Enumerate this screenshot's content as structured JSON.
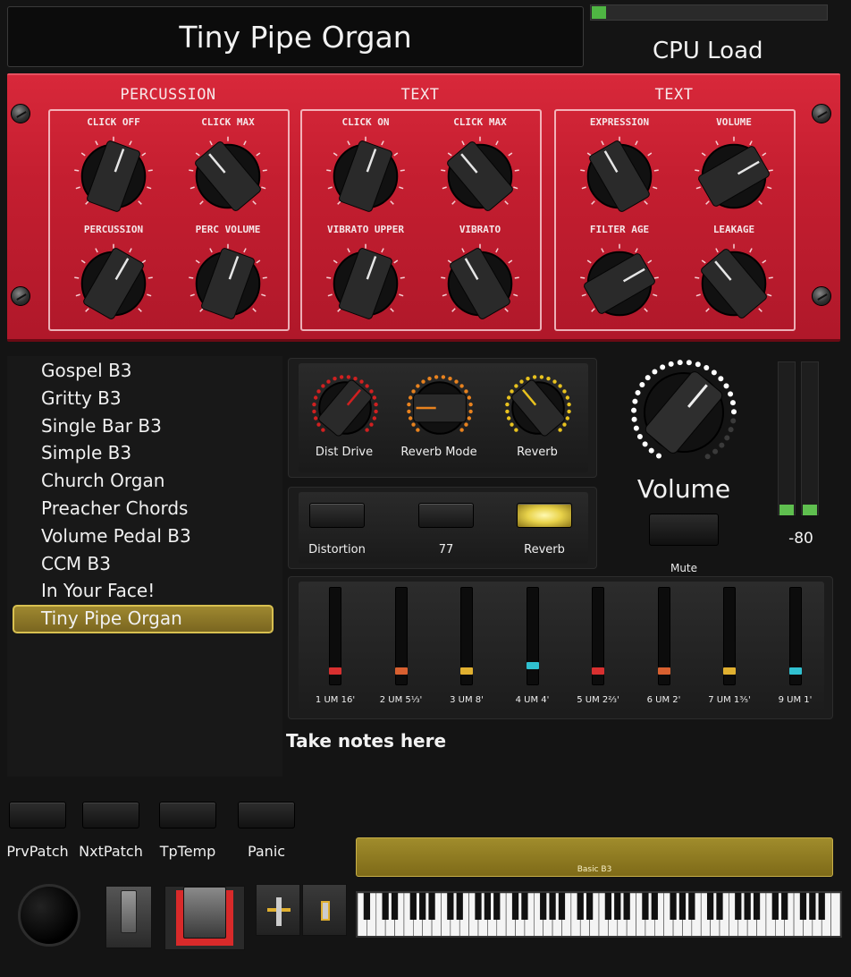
{
  "header": {
    "patch_title": "Tiny Pipe Organ",
    "cpu_label": "CPU Load",
    "cpu_load_fraction": 0.07
  },
  "organ_panel": {
    "sections": [
      {
        "label": "PERCUSSION",
        "knobs": [
          {
            "label": "CLICK OFF"
          },
          {
            "label": "CLICK MAX"
          },
          {
            "label": "PERCUSSION"
          },
          {
            "label": "PERC VOLUME"
          }
        ]
      },
      {
        "label": "TEXT",
        "knobs": [
          {
            "label": "CLICK ON"
          },
          {
            "label": "CLICK MAX"
          },
          {
            "label": "VIBRATO UPPER"
          },
          {
            "label": "VIBRATO"
          }
        ]
      },
      {
        "label": "TEXT",
        "knobs": [
          {
            "label": "EXPRESSION"
          },
          {
            "label": "VOLUME"
          },
          {
            "label": "FILTER AGE"
          },
          {
            "label": "LEAKAGE"
          }
        ]
      }
    ]
  },
  "patches": {
    "items": [
      "Gospel B3",
      "Gritty B3",
      "Single Bar B3",
      "Simple B3",
      "Church Organ",
      "Preacher Chords",
      "Volume Pedal B3",
      "CCM B3",
      "In Your Face!",
      "Tiny Pipe Organ"
    ],
    "selected_index": 9
  },
  "effects": {
    "knobs": [
      {
        "label": "Dist Drive",
        "ring_color": "#d02020"
      },
      {
        "label": "Reverb Mode",
        "ring_color": "#e8821e"
      },
      {
        "label": "Reverb",
        "ring_color": "#e8c21e"
      }
    ],
    "buttons": [
      {
        "label": "Distortion",
        "lit": false
      },
      {
        "label": "77",
        "lit": false
      },
      {
        "label": "Reverb",
        "lit": true
      }
    ]
  },
  "master": {
    "volume_label": "Volume",
    "mute_label": "Mute",
    "meter_value": "-80"
  },
  "drawbars": [
    {
      "label": "1 UM 16'",
      "color": "#d83030",
      "level": 0.1
    },
    {
      "label": "2 UM 5⅓'",
      "color": "#d86030",
      "level": 0.1
    },
    {
      "label": "3 UM 8'",
      "color": "#e0b030",
      "level": 0.1
    },
    {
      "label": "4 UM 4'",
      "color": "#30c0d0",
      "level": 0.2
    },
    {
      "label": "5 UM 2⅔'",
      "color": "#d83030",
      "level": 0.1
    },
    {
      "label": "6 UM 2'",
      "color": "#d86030",
      "level": 0.1
    },
    {
      "label": "7 UM 1⅗'",
      "color": "#e0b030",
      "level": 0.1
    },
    {
      "label": "9 UM 1'",
      "color": "#30c0d0",
      "level": 0.1
    }
  ],
  "notes": {
    "text": "Take notes here"
  },
  "transport": {
    "buttons": [
      {
        "label": "PrvPatch"
      },
      {
        "label": "NxtPatch"
      },
      {
        "label": "TpTemp"
      },
      {
        "label": "Panic"
      }
    ]
  },
  "keyboard": {
    "patch_name": "Basic B3",
    "white_key_count": 52
  },
  "colors": {
    "panel_red": "#c41e30",
    "selection_gold": "#d8c050",
    "meter_green": "#5fbf4f"
  }
}
